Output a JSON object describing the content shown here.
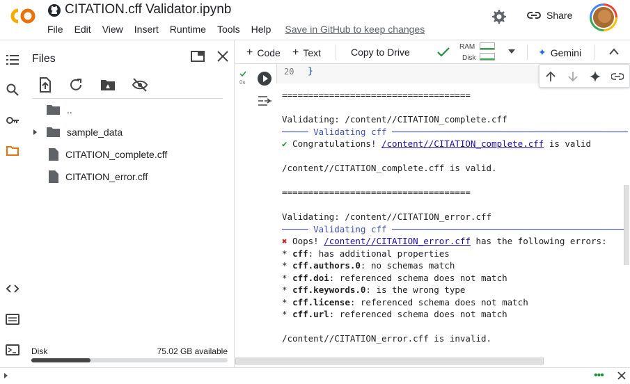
{
  "header": {
    "title": "CITATION.cff Validator.ipynb",
    "menu": [
      "File",
      "Edit",
      "View",
      "Insert",
      "Runtime",
      "Tools",
      "Help"
    ],
    "save_link": "Save in GitHub to keep changes",
    "share_label": "Share"
  },
  "files_panel": {
    "title": "Files",
    "tree": [
      {
        "label": "..",
        "type": "parent"
      },
      {
        "label": "sample_data",
        "type": "folder"
      },
      {
        "label": "CITATION_complete.cff",
        "type": "file"
      },
      {
        "label": "CITATION_error.cff",
        "type": "file"
      }
    ],
    "disk_label": "Disk",
    "disk_available": "75.02 GB available",
    "disk_used_fraction": 0.3
  },
  "toolbar": {
    "code_label": "Code",
    "text_label": "Text",
    "copy_to_drive": "Copy to Drive",
    "ram_label": "RAM",
    "disk_label": "Disk",
    "gemini_label": "Gemini"
  },
  "cell": {
    "exec_time": "0s",
    "line_number": "20",
    "code_text": "}",
    "output": {
      "separator": "====================================",
      "v1": "Validating: /content//CITATION_complete.cff",
      "header_rule_l": "───── ",
      "header_label": "Validating cff",
      "header_rule_r": " ─────────────────────────────────────────────",
      "check": "✔",
      "congrats": " Congratulations! ",
      "path_complete": "/content//CITATION_complete.cff",
      "is_valid": " is valid",
      "result_valid": "/content//CITATION_complete.cff is valid.",
      "v2": "Validating: /content//CITATION_error.cff",
      "cross": "✖",
      "oops": " Oops! ",
      "path_error": "/content//CITATION_error.cff",
      "has_errors": " has the following errors:",
      "errors": [
        {
          "key": "cff",
          "msg": ": has additional properties"
        },
        {
          "key": "cff.authors.0",
          "msg": ": no schemas match"
        },
        {
          "key": "cff.doi",
          "msg": ": referenced schema does not match"
        },
        {
          "key": "cff.keywords.0",
          "msg": ": is the wrong type"
        },
        {
          "key": "cff.license",
          "msg": ": referenced schema does not match"
        },
        {
          "key": "cff.url",
          "msg": ": referenced schema does not match"
        }
      ],
      "result_invalid": "/content//CITATION_error.cff is invalid."
    }
  },
  "colors": {
    "accent": "#1a73e8",
    "ok": "#1e8e3e",
    "error": "#c5221f",
    "colab_orange": "#f9ab00"
  }
}
